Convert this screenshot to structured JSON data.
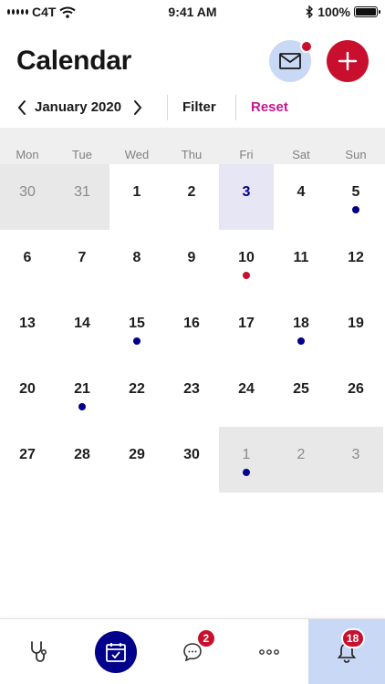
{
  "status_bar": {
    "carrier": "C4T",
    "time": "9:41 AM",
    "battery": "100%"
  },
  "header": {
    "title": "Calendar",
    "mail_has_notification": true
  },
  "month_nav": {
    "month": "January 2020",
    "filter_label": "Filter",
    "reset_label": "Reset"
  },
  "calendar": {
    "weekdays": [
      "Mon",
      "Tue",
      "Wed",
      "Thu",
      "Fri",
      "Sat",
      "Sun"
    ],
    "weeks": [
      [
        {
          "d": "30",
          "outside": true
        },
        {
          "d": "31",
          "outside": true
        },
        {
          "d": "1"
        },
        {
          "d": "2"
        },
        {
          "d": "3",
          "today": true
        },
        {
          "d": "4"
        },
        {
          "d": "5",
          "dot": "blue"
        }
      ],
      [
        {
          "d": "6"
        },
        {
          "d": "7"
        },
        {
          "d": "8"
        },
        {
          "d": "9"
        },
        {
          "d": "10",
          "dot": "red"
        },
        {
          "d": "11"
        },
        {
          "d": "12"
        }
      ],
      [
        {
          "d": "13"
        },
        {
          "d": "14"
        },
        {
          "d": "15",
          "dot": "blue"
        },
        {
          "d": "16"
        },
        {
          "d": "17"
        },
        {
          "d": "18",
          "dot": "blue"
        },
        {
          "d": "19"
        }
      ],
      [
        {
          "d": "20"
        },
        {
          "d": "21",
          "dot": "blue"
        },
        {
          "d": "22"
        },
        {
          "d": "23"
        },
        {
          "d": "24"
        },
        {
          "d": "25"
        },
        {
          "d": "26"
        }
      ],
      [
        {
          "d": "27"
        },
        {
          "d": "28"
        },
        {
          "d": "29"
        },
        {
          "d": "30"
        },
        {
          "d": "1",
          "outside": true,
          "dot": "blue"
        },
        {
          "d": "2",
          "outside": true
        },
        {
          "d": "3",
          "outside": true
        }
      ]
    ]
  },
  "tab_bar": {
    "tabs": [
      {
        "icon": "stethoscope-icon"
      },
      {
        "icon": "calendar-check-icon",
        "active": true
      },
      {
        "icon": "chat-bubble-icon",
        "badge": "2"
      },
      {
        "icon": "more-dots-icon"
      },
      {
        "icon": "bell-icon",
        "badge": "18",
        "highlighted": true
      }
    ]
  },
  "colors": {
    "brand_blue": "#00008b",
    "brand_red": "#c8102e",
    "accent_pink": "#c8168e",
    "light_blue": "#c9d8f5"
  }
}
